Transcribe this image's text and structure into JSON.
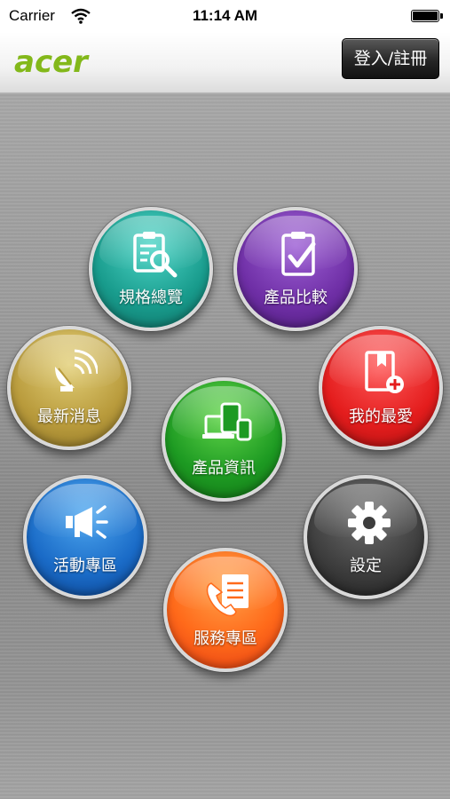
{
  "status_bar": {
    "carrier": "Carrier",
    "time": "11:14 AM",
    "battery_level": 1.0
  },
  "header": {
    "logo_text": "acer",
    "login_label": "登入/註冊"
  },
  "menu": {
    "spec_overview": "規格總覽",
    "product_compare": "產品比較",
    "latest_news": "最新消息",
    "my_favorites": "我的最愛",
    "product_info": "產品資訊",
    "events": "活動專區",
    "settings": "設定",
    "service": "服務專區"
  },
  "colors": {
    "brand_green": "#83b81a",
    "spec": "#189b8c",
    "compare": "#6f2fa6",
    "news": "#b99b3c",
    "favorites": "#e41d1d",
    "product": "#1d9a22",
    "events": "#1a6bc7",
    "settings": "#3d3d3d",
    "service": "#ff6a1a"
  },
  "icons": {
    "spec": "clipboard-search-icon",
    "compare": "clipboard-check-icon",
    "news": "satellite-dish-icon",
    "favorites": "book-plus-icon",
    "product": "devices-icon",
    "events": "megaphone-icon",
    "settings": "gear-icon",
    "service": "phone-document-icon"
  }
}
